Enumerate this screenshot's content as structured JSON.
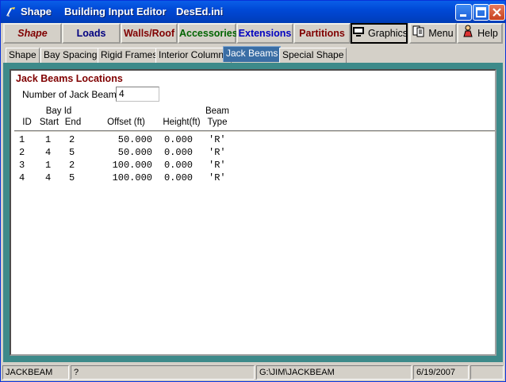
{
  "window": {
    "title_app": "Shape",
    "title_mid": "Building Input Editor",
    "title_file": "DesEd.ini"
  },
  "colors": {
    "titlebar": "#0049d6",
    "panel_border": "#3d8a8a",
    "heading": "#800000",
    "tab_active": "#3a6ea5"
  },
  "toolbar": {
    "buttons": [
      {
        "label": "Shape",
        "color": "#800000",
        "italic": true
      },
      {
        "label": "Loads",
        "color": "#000080"
      },
      {
        "label": "Walls/Roof",
        "color": "#800000"
      },
      {
        "label": "Accessories",
        "color": "#006400"
      },
      {
        "label": "Extensions",
        "color": "#0000c0"
      },
      {
        "label": "Partitions",
        "color": "#800000"
      },
      {
        "label": "Graphics",
        "icon": "monitor-icon"
      },
      {
        "label": "Menu",
        "icon": "pages-icon"
      },
      {
        "label": "Help",
        "icon": "help-person-icon"
      }
    ]
  },
  "tabs": [
    "Shape",
    "Bay Spacing",
    "Rigid Frames",
    "Interior Columns",
    "Jack Beams",
    "Special Shape"
  ],
  "panel": {
    "heading": "Jack Beams Locations",
    "count_label": "Number of Jack Beams",
    "count_value": "4",
    "headers": {
      "id": "ID",
      "bay_id": "Bay Id",
      "start": "Start",
      "end": "End",
      "offset": "Offset (ft)",
      "height": "Height(ft)",
      "beam": "Beam",
      "type": "Type"
    },
    "rows": [
      {
        "id": "1",
        "start": "1",
        "end": "2",
        "offset": "50.000",
        "height": "0.000",
        "type": "'R'"
      },
      {
        "id": "2",
        "start": "4",
        "end": "5",
        "offset": "50.000",
        "height": "0.000",
        "type": "'R'"
      },
      {
        "id": "3",
        "start": "1",
        "end": "2",
        "offset": "100.000",
        "height": "0.000",
        "type": "'R'"
      },
      {
        "id": "4",
        "start": "4",
        "end": "5",
        "offset": "100.000",
        "height": "0.000",
        "type": "'R'"
      }
    ]
  },
  "status": {
    "field1": "JACKBEAM",
    "field2": "?",
    "field3": "G:\\JIM\\JACKBEAM",
    "field4": "6/19/2007",
    "field5": ""
  }
}
